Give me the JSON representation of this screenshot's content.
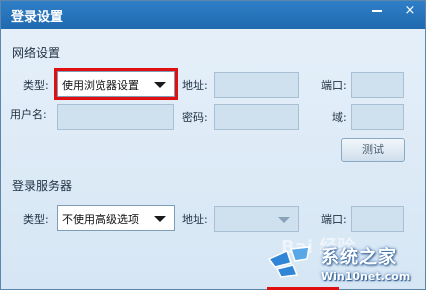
{
  "window": {
    "title": "登录设置",
    "minimize_icon": "minimize-icon",
    "close_icon": "close-icon",
    "close_glyph": "×"
  },
  "network": {
    "section_title": "网络设置",
    "type_label": "类型:",
    "type_value": "使用浏览器设置",
    "address_label": "地址:",
    "address_value": "",
    "port_label": "端口:",
    "port_value": "",
    "username_label": "用户名:",
    "username_value": "",
    "password_label": "密码:",
    "password_value": "",
    "domain_label": "域:",
    "domain_value": "",
    "test_button": "测试"
  },
  "server": {
    "section_title": "登录服务器",
    "type_label": "类型:",
    "type_value": "不使用高级选项",
    "address_label": "地址:",
    "address_value": "",
    "port_label": "端口:",
    "port_value": ""
  },
  "watermark": {
    "brand": "系统之家",
    "url": "Win10net.com",
    "faint_text": "Bai 经验"
  },
  "colors": {
    "titlebar": "#1f69b0",
    "highlight": "#e01010",
    "field_disabled": "#cfe0ee"
  }
}
